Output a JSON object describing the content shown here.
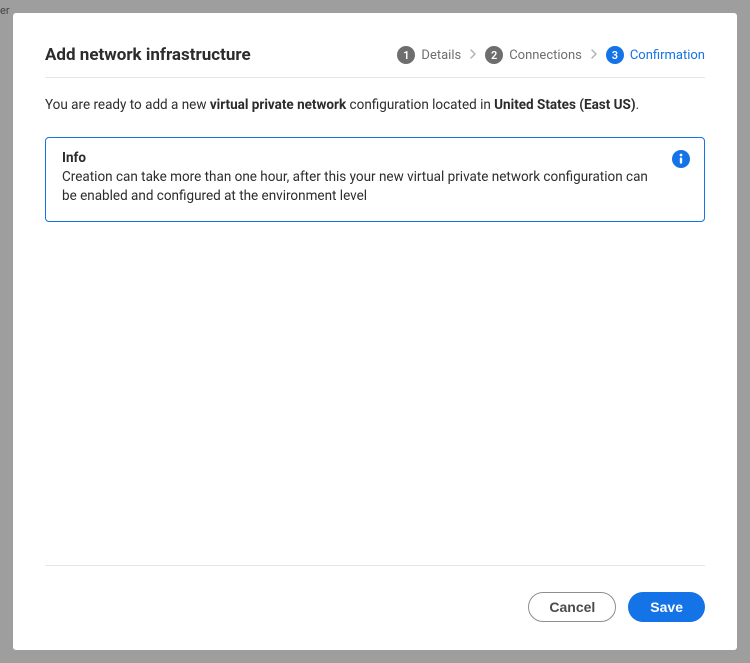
{
  "header": {
    "title": "Add network infrastructure",
    "steps": [
      {
        "num": "1",
        "label": "Details"
      },
      {
        "num": "2",
        "label": "Connections"
      },
      {
        "num": "3",
        "label": "Confirmation"
      }
    ]
  },
  "body": {
    "ready_prefix": "You are ready to add a new ",
    "ready_bold1": "virtual private network",
    "ready_mid": " configuration located in ",
    "ready_bold2": "United States (East US)",
    "ready_suffix": ".",
    "info_title": "Info",
    "info_body": "Creation can take more than one hour, after this your new virtual private network configuration can be enabled and configured at the environment level"
  },
  "footer": {
    "cancel": "Cancel",
    "save": "Save"
  }
}
